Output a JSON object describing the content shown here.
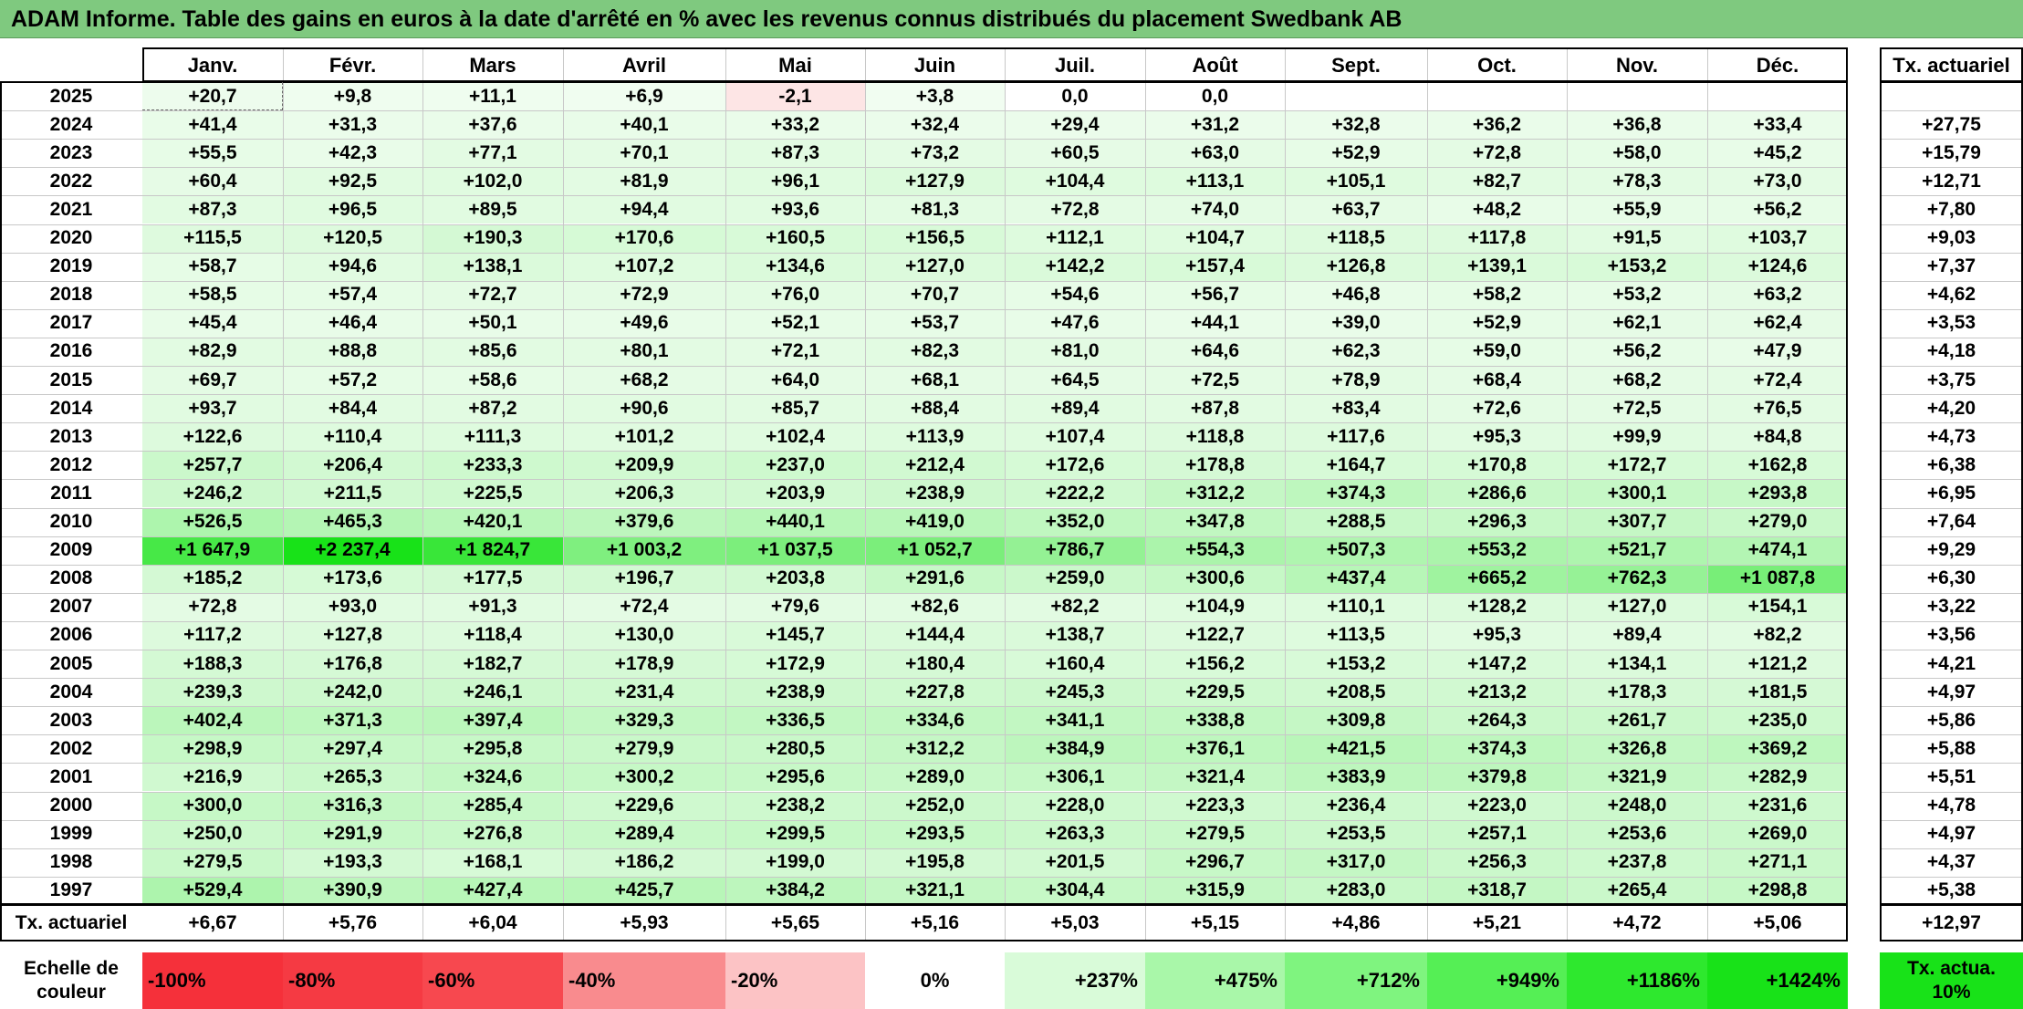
{
  "title": "ADAM Informe. Table des gains en euros à la date d'arrêté en % avec les revenus connus distribués du placement Swedbank AB",
  "chart_data": {
    "type": "table",
    "title": "ADAM Informe. Table des gains en euros à la date d'arrêté en % avec les revenus connus distribués du placement Swedbank AB",
    "columns": [
      "Janv.",
      "Févr.",
      "Mars",
      "Avril",
      "Mai",
      "Juin",
      "Juil.",
      "Août",
      "Sept.",
      "Oct.",
      "Nov.",
      "Déc."
    ],
    "annual_header": "Tx. actuariel",
    "rows": [
      {
        "year": "2025",
        "values": [
          "+20,7",
          "+9,8",
          "+11,1",
          "+6,9",
          "-2,1",
          "+3,8",
          "0,0",
          "0,0",
          "",
          "",
          "",
          ""
        ],
        "rate": ""
      },
      {
        "year": "2024",
        "values": [
          "+41,4",
          "+31,3",
          "+37,6",
          "+40,1",
          "+33,2",
          "+32,4",
          "+29,4",
          "+31,2",
          "+32,8",
          "+36,2",
          "+36,8",
          "+33,4"
        ],
        "rate": "+27,75"
      },
      {
        "year": "2023",
        "values": [
          "+55,5",
          "+42,3",
          "+77,1",
          "+70,1",
          "+87,3",
          "+73,2",
          "+60,5",
          "+63,0",
          "+52,9",
          "+72,8",
          "+58,0",
          "+45,2"
        ],
        "rate": "+15,79"
      },
      {
        "year": "2022",
        "values": [
          "+60,4",
          "+92,5",
          "+102,0",
          "+81,9",
          "+96,1",
          "+127,9",
          "+104,4",
          "+113,1",
          "+105,1",
          "+82,7",
          "+78,3",
          "+73,0"
        ],
        "rate": "+12,71"
      },
      {
        "year": "2021",
        "values": [
          "+87,3",
          "+96,5",
          "+89,5",
          "+94,4",
          "+93,6",
          "+81,3",
          "+72,8",
          "+74,0",
          "+63,7",
          "+48,2",
          "+55,9",
          "+56,2"
        ],
        "rate": "+7,80"
      },
      {
        "year": "2020",
        "values": [
          "+115,5",
          "+120,5",
          "+190,3",
          "+170,6",
          "+160,5",
          "+156,5",
          "+112,1",
          "+104,7",
          "+118,5",
          "+117,8",
          "+91,5",
          "+103,7"
        ],
        "rate": "+9,03"
      },
      {
        "year": "2019",
        "values": [
          "+58,7",
          "+94,6",
          "+138,1",
          "+107,2",
          "+134,6",
          "+127,0",
          "+142,2",
          "+157,4",
          "+126,8",
          "+139,1",
          "+153,2",
          "+124,6"
        ],
        "rate": "+7,37"
      },
      {
        "year": "2018",
        "values": [
          "+58,5",
          "+57,4",
          "+72,7",
          "+72,9",
          "+76,0",
          "+70,7",
          "+54,6",
          "+56,7",
          "+46,8",
          "+58,2",
          "+53,2",
          "+63,2"
        ],
        "rate": "+4,62"
      },
      {
        "year": "2017",
        "values": [
          "+45,4",
          "+46,4",
          "+50,1",
          "+49,6",
          "+52,1",
          "+53,7",
          "+47,6",
          "+44,1",
          "+39,0",
          "+52,9",
          "+62,1",
          "+62,4"
        ],
        "rate": "+3,53"
      },
      {
        "year": "2016",
        "values": [
          "+82,9",
          "+88,8",
          "+85,6",
          "+80,1",
          "+72,1",
          "+82,3",
          "+81,0",
          "+64,6",
          "+62,3",
          "+59,0",
          "+56,2",
          "+47,9"
        ],
        "rate": "+4,18"
      },
      {
        "year": "2015",
        "values": [
          "+69,7",
          "+57,2",
          "+58,6",
          "+68,2",
          "+64,0",
          "+68,1",
          "+64,5",
          "+72,5",
          "+78,9",
          "+68,4",
          "+68,2",
          "+72,4"
        ],
        "rate": "+3,75"
      },
      {
        "year": "2014",
        "values": [
          "+93,7",
          "+84,4",
          "+87,2",
          "+90,6",
          "+85,7",
          "+88,4",
          "+89,4",
          "+87,8",
          "+83,4",
          "+72,6",
          "+72,5",
          "+76,5"
        ],
        "rate": "+4,20"
      },
      {
        "year": "2013",
        "values": [
          "+122,6",
          "+110,4",
          "+111,3",
          "+101,2",
          "+102,4",
          "+113,9",
          "+107,4",
          "+118,8",
          "+117,6",
          "+95,3",
          "+99,9",
          "+84,8"
        ],
        "rate": "+4,73"
      },
      {
        "year": "2012",
        "values": [
          "+257,7",
          "+206,4",
          "+233,3",
          "+209,9",
          "+237,0",
          "+212,4",
          "+172,6",
          "+178,8",
          "+164,7",
          "+170,8",
          "+172,7",
          "+162,8"
        ],
        "rate": "+6,38"
      },
      {
        "year": "2011",
        "values": [
          "+246,2",
          "+211,5",
          "+225,5",
          "+206,3",
          "+203,9",
          "+238,9",
          "+222,2",
          "+312,2",
          "+374,3",
          "+286,6",
          "+300,1",
          "+293,8"
        ],
        "rate": "+6,95"
      },
      {
        "year": "2010",
        "values": [
          "+526,5",
          "+465,3",
          "+420,1",
          "+379,6",
          "+440,1",
          "+419,0",
          "+352,0",
          "+347,8",
          "+288,5",
          "+296,3",
          "+307,7",
          "+279,0"
        ],
        "rate": "+7,64"
      },
      {
        "year": "2009",
        "values": [
          "+1 647,9",
          "+2 237,4",
          "+1 824,7",
          "+1 003,2",
          "+1 037,5",
          "+1 052,7",
          "+786,7",
          "+554,3",
          "+507,3",
          "+553,2",
          "+521,7",
          "+474,1"
        ],
        "rate": "+9,29"
      },
      {
        "year": "2008",
        "values": [
          "+185,2",
          "+173,6",
          "+177,5",
          "+196,7",
          "+203,8",
          "+291,6",
          "+259,0",
          "+300,6",
          "+437,4",
          "+665,2",
          "+762,3",
          "+1 087,8"
        ],
        "rate": "+6,30"
      },
      {
        "year": "2007",
        "values": [
          "+72,8",
          "+93,0",
          "+91,3",
          "+72,4",
          "+79,6",
          "+82,6",
          "+82,2",
          "+104,9",
          "+110,1",
          "+128,2",
          "+127,0",
          "+154,1"
        ],
        "rate": "+3,22"
      },
      {
        "year": "2006",
        "values": [
          "+117,2",
          "+127,8",
          "+118,4",
          "+130,0",
          "+145,7",
          "+144,4",
          "+138,7",
          "+122,7",
          "+113,5",
          "+95,3",
          "+89,4",
          "+82,2"
        ],
        "rate": "+3,56"
      },
      {
        "year": "2005",
        "values": [
          "+188,3",
          "+176,8",
          "+182,7",
          "+178,9",
          "+172,9",
          "+180,4",
          "+160,4",
          "+156,2",
          "+153,2",
          "+147,2",
          "+134,1",
          "+121,2"
        ],
        "rate": "+4,21"
      },
      {
        "year": "2004",
        "values": [
          "+239,3",
          "+242,0",
          "+246,1",
          "+231,4",
          "+238,9",
          "+227,8",
          "+245,3",
          "+229,5",
          "+208,5",
          "+213,2",
          "+178,3",
          "+181,5"
        ],
        "rate": "+4,97"
      },
      {
        "year": "2003",
        "values": [
          "+402,4",
          "+371,3",
          "+397,4",
          "+329,3",
          "+336,5",
          "+334,6",
          "+341,1",
          "+338,8",
          "+309,8",
          "+264,3",
          "+261,7",
          "+235,0"
        ],
        "rate": "+5,86"
      },
      {
        "year": "2002",
        "values": [
          "+298,9",
          "+297,4",
          "+295,8",
          "+279,9",
          "+280,5",
          "+312,2",
          "+384,9",
          "+376,1",
          "+421,5",
          "+374,3",
          "+326,8",
          "+369,2"
        ],
        "rate": "+5,88"
      },
      {
        "year": "2001",
        "values": [
          "+216,9",
          "+265,3",
          "+324,6",
          "+300,2",
          "+295,6",
          "+289,0",
          "+306,1",
          "+321,4",
          "+383,9",
          "+379,8",
          "+321,9",
          "+282,9"
        ],
        "rate": "+5,51"
      },
      {
        "year": "2000",
        "values": [
          "+300,0",
          "+316,3",
          "+285,4",
          "+229,6",
          "+238,2",
          "+252,0",
          "+228,0",
          "+223,3",
          "+236,4",
          "+223,0",
          "+248,0",
          "+231,6"
        ],
        "rate": "+4,78"
      },
      {
        "year": "1999",
        "values": [
          "+250,0",
          "+291,9",
          "+276,8",
          "+289,4",
          "+299,5",
          "+293,5",
          "+263,3",
          "+279,5",
          "+253,5",
          "+257,1",
          "+253,6",
          "+269,0"
        ],
        "rate": "+4,97"
      },
      {
        "year": "1998",
        "values": [
          "+279,5",
          "+193,3",
          "+168,1",
          "+186,2",
          "+199,0",
          "+195,8",
          "+201,5",
          "+296,7",
          "+317,0",
          "+256,3",
          "+237,8",
          "+271,1"
        ],
        "rate": "+4,37"
      },
      {
        "year": "1997",
        "values": [
          "+529,4",
          "+390,9",
          "+427,4",
          "+425,7",
          "+384,2",
          "+321,1",
          "+304,4",
          "+315,9",
          "+283,0",
          "+318,7",
          "+265,4",
          "+298,8"
        ],
        "rate": "+5,38"
      }
    ],
    "footer": {
      "label": "Tx. actuariel",
      "values": [
        "+6,67",
        "+5,76",
        "+6,04",
        "+5,93",
        "+5,65",
        "+5,16",
        "+5,03",
        "+5,15",
        "+4,86",
        "+5,21",
        "+4,72",
        "+5,06"
      ],
      "rate": "+12,97"
    },
    "scale": {
      "label": "Echelle de couleur",
      "steps": [
        {
          "text": "-100%",
          "color": "#f5303a"
        },
        {
          "text": "-80%",
          "color": "#f53a43"
        },
        {
          "text": "-60%",
          "color": "#f7484f"
        },
        {
          "text": "-40%",
          "color": "#f98b8e"
        },
        {
          "text": "-20%",
          "color": "#fcc3c5"
        },
        {
          "text": "0%",
          "color": "#ffffff"
        },
        {
          "text": "+237%",
          "color": "#d9fbd9"
        },
        {
          "text": "+475%",
          "color": "#a9f7a9"
        },
        {
          "text": "+712%",
          "color": "#7ff47f"
        },
        {
          "text": "+949%",
          "color": "#55ef55"
        },
        {
          "text": "+1186%",
          "color": "#2ee82e"
        },
        {
          "text": "+1424%",
          "color": "#18e218"
        }
      ],
      "rate_label": "Tx. actua. 10%",
      "rate_color": "#18e218"
    },
    "colors": {
      "title_bar": "#7fc97f",
      "max_positive": "#18e218",
      "max_negative": "#f5303a"
    }
  }
}
